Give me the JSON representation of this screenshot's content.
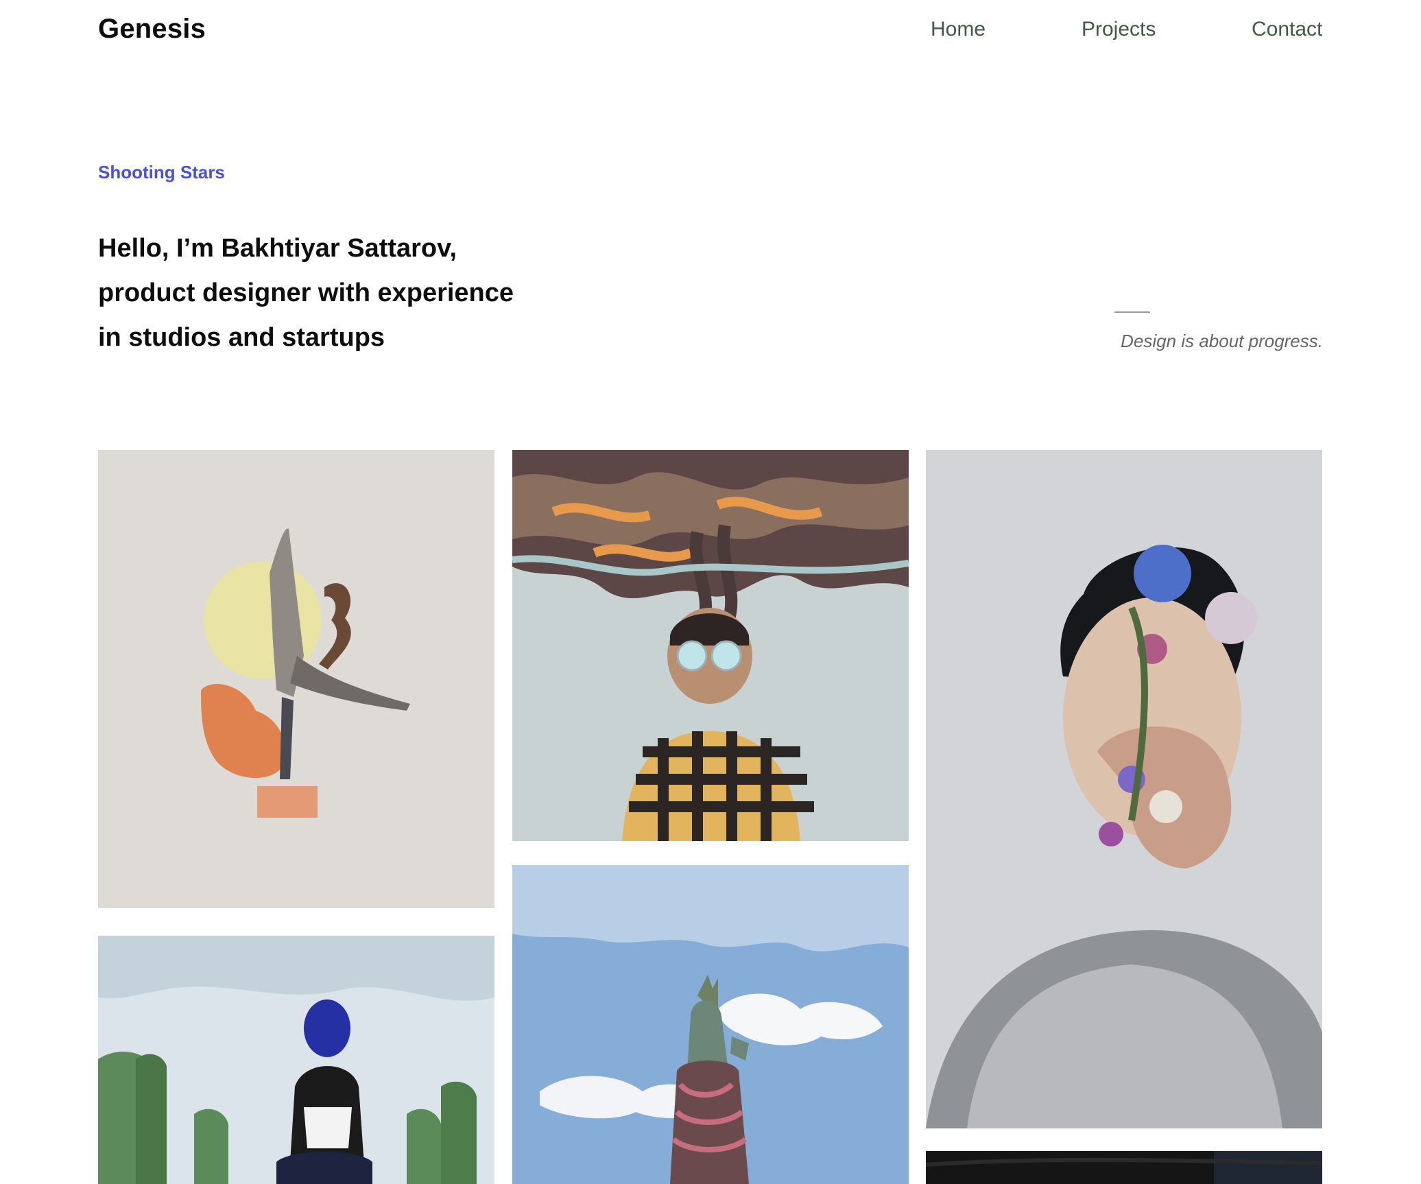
{
  "header": {
    "logo": "Genesis",
    "nav": [
      {
        "label": "Home"
      },
      {
        "label": "Projects"
      },
      {
        "label": "Contact"
      }
    ]
  },
  "hero": {
    "eyebrow": "Shooting Stars",
    "headline_lines": [
      "Hello, I’m Bakhtiyar Sattarov,",
      "product designer with experience",
      "in studios and startups"
    ],
    "tagline": "Design is about progress."
  },
  "gallery": {
    "items": [
      {
        "subject": "collage-dancer-with-sun"
      },
      {
        "subject": "man-with-glasses-and-swirling-clouds"
      },
      {
        "subject": "man-with-flowers-on-face"
      },
      {
        "subject": "person-with-blue-balloon-and-cactus"
      },
      {
        "subject": "statue-of-liberty-sky"
      },
      {
        "subject": "dark-photo"
      }
    ]
  },
  "colors": {
    "accent": "#4b50d8",
    "nav_text": "#3f5a45",
    "heading_text": "#0d0d0d",
    "muted_text": "#666666"
  }
}
